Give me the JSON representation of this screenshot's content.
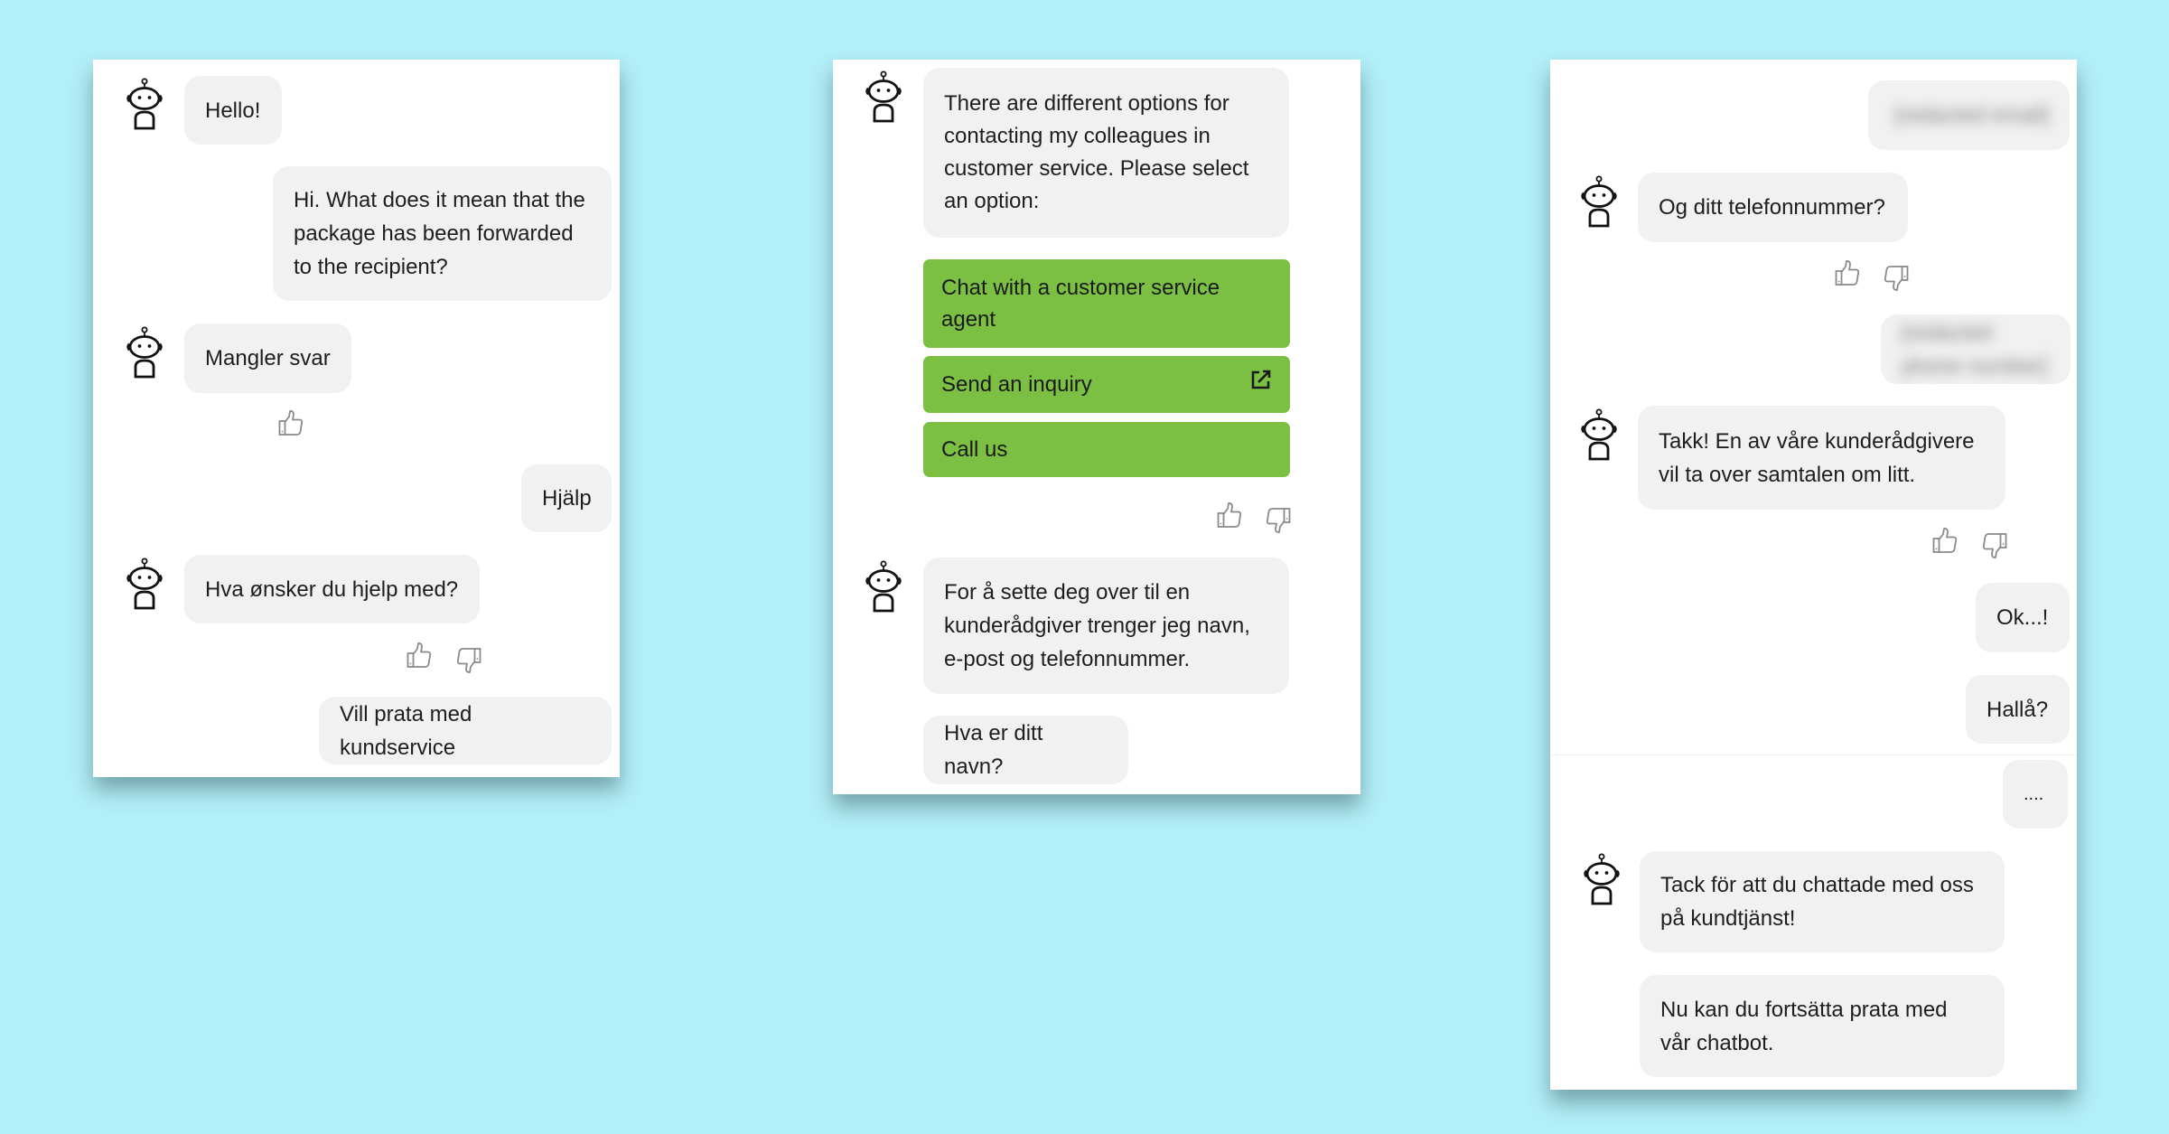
{
  "colors": {
    "background": "#b3eff8",
    "bubble": "#f1f1f1",
    "option_button": "#7bc043",
    "icon_gray": "#8a8a8a"
  },
  "panels": [
    {
      "messages": [
        {
          "sender": "bot",
          "text": "Hello!"
        },
        {
          "sender": "user",
          "text": "Hi. What does it mean that the\npackage has been forwarded\nto the recipient?"
        },
        {
          "sender": "bot",
          "text": "Mangler svar",
          "feedback": [
            "thumbs-up"
          ]
        },
        {
          "sender": "user",
          "text": "Hjälp"
        },
        {
          "sender": "bot",
          "text": "Hva ønsker du hjelp med?",
          "feedback": [
            "thumbs-up",
            "thumbs-down"
          ]
        },
        {
          "sender": "user",
          "text": "Vill prata med kundservice"
        }
      ]
    },
    {
      "messages": [
        {
          "sender": "bot",
          "text": "There are different options for\ncontacting my colleagues in\ncustomer service. Please select\nan option:"
        },
        {
          "sender": "bot",
          "text": "For å sette deg over til en\nkunderådgiver trenger jeg navn,\ne-post og telefonnummer."
        },
        {
          "sender": "bot",
          "text": "Hva er ditt navn?"
        }
      ],
      "options": [
        {
          "label": "Chat with a customer service\nagent",
          "icon": null
        },
        {
          "label": "Send an inquiry",
          "icon": "external-link-icon"
        },
        {
          "label": "Call us",
          "icon": null
        }
      ]
    },
    {
      "messages": [
        {
          "sender": "user",
          "text": "[redacted email]",
          "redacted": true
        },
        {
          "sender": "bot",
          "text": "Og ditt telefonnummer?",
          "feedback": [
            "thumbs-up",
            "thumbs-down"
          ]
        },
        {
          "sender": "user",
          "text": "[redacted phone number]",
          "redacted": true
        },
        {
          "sender": "bot",
          "text": "Takk! En av våre kunderådgivere\nvil ta over samtalen om litt.",
          "feedback": [
            "thumbs-up",
            "thumbs-down"
          ]
        },
        {
          "sender": "user",
          "text": "Ok...!"
        },
        {
          "sender": "user",
          "text": "Hallå?"
        },
        {
          "sender": "user",
          "text": "...."
        },
        {
          "sender": "bot",
          "text": "Tack för att du chattade med oss\npå kundtjänst!"
        },
        {
          "sender": "bot",
          "text": "Nu kan du fortsätta prata med\nvår chatbot."
        }
      ]
    }
  ]
}
